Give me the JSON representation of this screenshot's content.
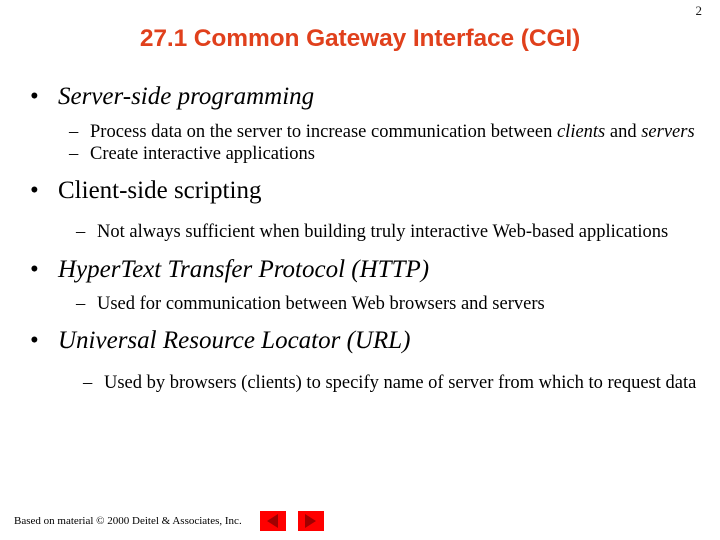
{
  "slide": {
    "page_number": "2",
    "title": "27.1 Common Gateway Interface (CGI)",
    "title_color": "#E0401C",
    "background_color": "#FFFFFF",
    "text_color": "#000000"
  },
  "bullets": [
    {
      "marker": "•",
      "text": "Server-side programming",
      "style": "italic",
      "children": [
        {
          "marker": "–",
          "segments": [
            {
              "text": "Process data on the server to increase communication between ",
              "style": "normal"
            },
            {
              "text": "clients",
              "style": "italic"
            },
            {
              "text": " and ",
              "style": "normal"
            },
            {
              "text": "servers",
              "style": "italic"
            }
          ]
        },
        {
          "marker": "–",
          "segments": [
            {
              "text": "Create interactive applications",
              "style": "normal"
            }
          ]
        }
      ]
    },
    {
      "marker": "•",
      "text": "Client-side scripting",
      "style": "normal",
      "children": [
        {
          "marker": "–",
          "segments": [
            {
              "text": "Not always sufficient when building truly interactive Web-based applications",
              "style": "normal"
            }
          ]
        }
      ]
    },
    {
      "marker": "•",
      "text": "HyperText Transfer Protocol (HTTP)",
      "style": "italic",
      "children": [
        {
          "marker": "–",
          "segments": [
            {
              "text": "Used for communication between Web browsers and servers",
              "style": "normal"
            }
          ]
        }
      ]
    },
    {
      "marker": "•",
      "text": "Universal Resource Locator (URL)",
      "style": "italic",
      "children": [
        {
          "marker": "–",
          "segments": [
            {
              "text": "Used by browsers (clients) to specify name of  server from which to request data",
              "style": "normal"
            }
          ]
        }
      ]
    }
  ],
  "footer": {
    "credit": "Based on material © 2000 Deitel & Associates, Inc.",
    "nav": {
      "previous_icon": "triangle-left-icon",
      "next_icon": "triangle-right-icon",
      "button_color": "#FF0000",
      "arrow_color": "#A00000"
    }
  }
}
